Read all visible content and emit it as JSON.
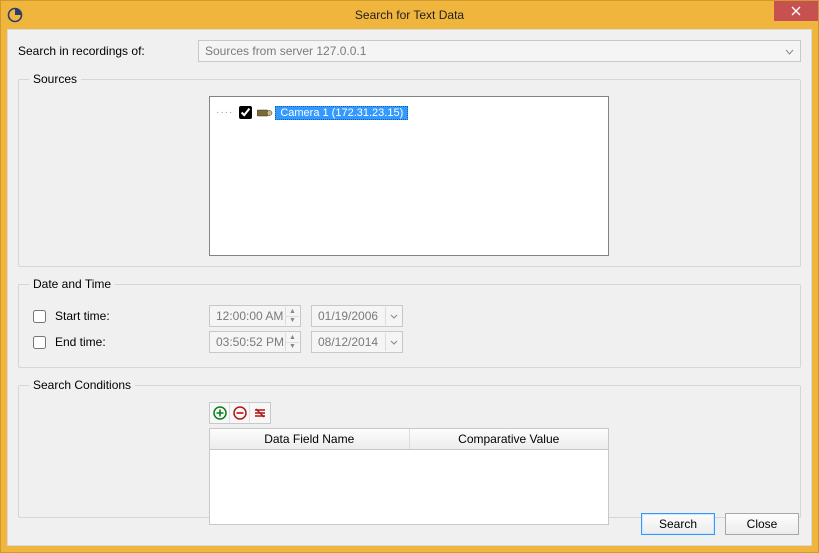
{
  "window": {
    "title": "Search for Text Data"
  },
  "search_in": {
    "label": "Search in recordings of:",
    "selected": "Sources from server 127.0.0.1"
  },
  "sources": {
    "legend": "Sources",
    "items": [
      {
        "checked": true,
        "label": "Camera 1 (172.31.23.15)"
      }
    ]
  },
  "datetime": {
    "legend": "Date and Time",
    "start": {
      "label": "Start time:",
      "time": "12:00:00 AM",
      "date": "01/19/2006",
      "enabled": false
    },
    "end": {
      "label": "End time:",
      "time": "03:50:52 PM",
      "date": "08/12/2014",
      "enabled": false
    }
  },
  "conditions": {
    "legend": "Search Conditions",
    "columns": {
      "name": "Data Field Name",
      "value": "Comparative Value"
    }
  },
  "buttons": {
    "search": "Search",
    "close": "Close"
  }
}
